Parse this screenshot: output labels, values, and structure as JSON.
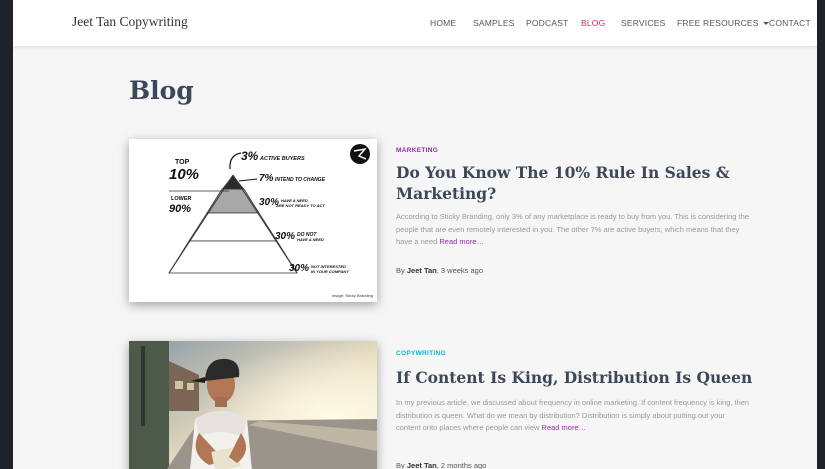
{
  "brand": "Jeet Tan Copywriting",
  "nav": {
    "home": "HOME",
    "samples": "SAMPLES",
    "podcast": "PODCAST",
    "blog": "BLOG",
    "services": "SERVICES",
    "free_resources": "FREE RESOURCES",
    "contact": "CONTACT"
  },
  "page_title": "Blog",
  "posts": [
    {
      "category": "MARKETING",
      "title": "Do You Know The 10% Rule In Sales & Marketing?",
      "excerpt": "According to Sticky Branding, only 3% of any marketplace is ready to buy from you. This is considering the people that are even remotely interested in you. The other 7% are active buyers, which means that they have a need",
      "read_more": "Read more…",
      "by": "By",
      "author": "Jeet Tan",
      "time": ", 3 weeks ago",
      "image": {
        "top_label": "TOP",
        "top_value": "10%",
        "lower_label": "LOWER",
        "lower_value": "90%",
        "tier1_value": "3%",
        "tier1_text": "ACTIVE BUYERS",
        "tier2_value": "7%",
        "tier2_text": "INTEND TO CHANGE",
        "tier3_value": "30%",
        "tier3_text_a": "HAVE A NEED",
        "tier3_text_b": "ARE NOT READY TO ACT",
        "tier4_value": "30%",
        "tier4_text_a": "DO NOT",
        "tier4_text_b": "HAVE A NEED",
        "tier5_value": "30%",
        "tier5_text_a": "NOT INTERESTED",
        "tier5_text_b": "IN YOUR COMPANY",
        "credit": "Image: Sticky Branding"
      }
    },
    {
      "category": "COPYWRITING",
      "title": "If Content Is King, Distribution Is Queen",
      "excerpt": "In my previous article, we discussed about frequency in online marketing. If content frequency is king, then distribution is queen. What do we mean by distribution? Distribution is simply about putting out your content onto places where people can view",
      "read_more": "Read more…",
      "by": "By",
      "author": "Jeet Tan",
      "time": ", 2 months ago"
    }
  ]
}
